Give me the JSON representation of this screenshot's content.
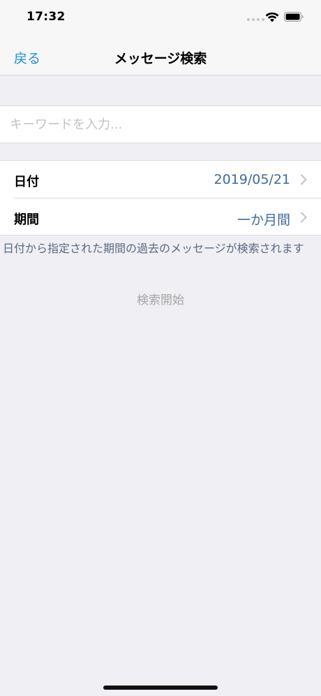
{
  "status_bar": {
    "time": "17:32",
    "icons": [
      "signal-dots-icon",
      "wifi-icon",
      "battery-icon"
    ]
  },
  "nav": {
    "back_label": "戻る",
    "title": "メッセージ検索"
  },
  "search": {
    "value": "",
    "placeholder": "キーワードを入力..."
  },
  "rows": {
    "date": {
      "label": "日付",
      "value": "2019/05/21"
    },
    "period": {
      "label": "期間",
      "value": "一か月間"
    }
  },
  "description": "日付から指定された期間の過去のメッセージが検索されます",
  "search_button_label": "検索開始",
  "colors": {
    "accent": "#1a8fd6",
    "value_text": "#3e6a9a",
    "background": "#efeff4",
    "disabled_text": "#a6a6a6"
  }
}
